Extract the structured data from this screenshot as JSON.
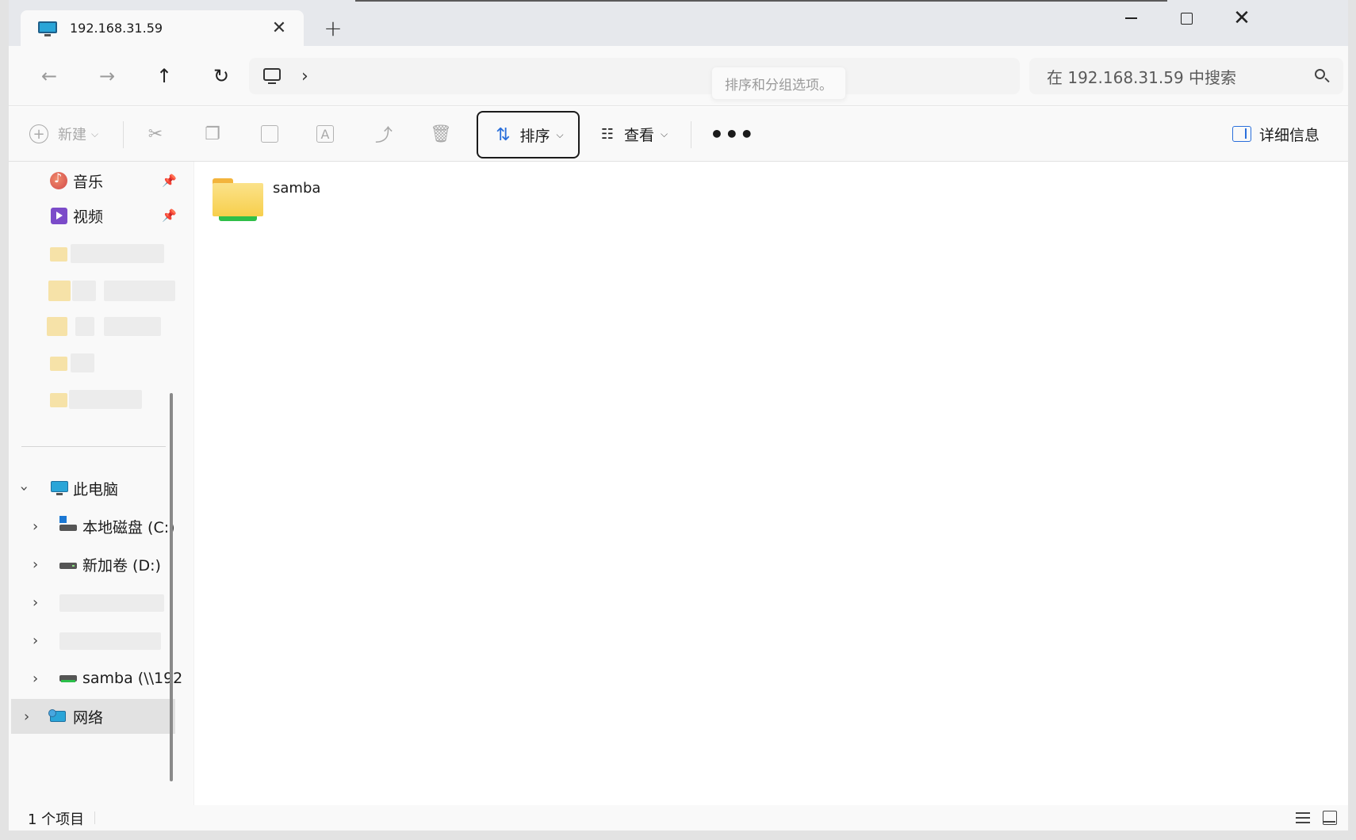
{
  "tab": {
    "title": "192.168.31.59",
    "close": "✕",
    "new_tab": "+"
  },
  "window_controls": {
    "close": "✕"
  },
  "nav": {
    "back": "←",
    "forward": "→",
    "up": "↑",
    "refresh": "↻"
  },
  "address": {
    "chevron": "›",
    "tooltip": "排序和分组选项。"
  },
  "search": {
    "placeholder": "在 192.168.31.59 中搜索"
  },
  "commands": {
    "new_label": "新建",
    "sort_label": "排序",
    "view_label": "查看",
    "more": "•••",
    "details_label": "详细信息"
  },
  "sidebar": {
    "quick_access": [
      {
        "label": "音乐",
        "icon": "music-icon",
        "pinned": true
      },
      {
        "label": "视频",
        "icon": "video-icon",
        "pinned": true
      }
    ],
    "this_pc": {
      "label": "此电脑",
      "icon": "pc-icon",
      "expanded": true
    },
    "drives": [
      {
        "label": "本地磁盘 (C:)",
        "icon": "local-drive-icon"
      },
      {
        "label": "新加卷 (D:)",
        "icon": "drive-icon"
      },
      {
        "label": "samba (\\\\192",
        "icon": "network-drive-icon"
      }
    ],
    "network": {
      "label": "网络",
      "icon": "network-icon",
      "selected": true
    }
  },
  "content": {
    "items": [
      {
        "name": "samba",
        "icon": "network-folder-icon"
      }
    ]
  },
  "status": {
    "item_count": "1 个项目"
  },
  "colors": {
    "accent": "#2a6fdb",
    "selected_bg": "#e2e2e2",
    "folder": "#f7cf4c",
    "network_green": "#2fbf49"
  }
}
